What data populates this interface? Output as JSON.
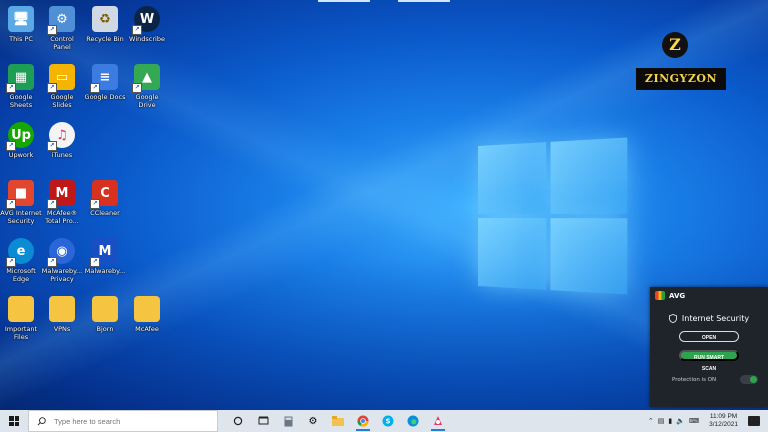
{
  "desktop": {
    "icons": [
      {
        "label": "This PC",
        "icon": "this-pc-icon",
        "color": "#5aa9e6"
      },
      {
        "label": "Control\nPanel",
        "icon": "control-panel-icon",
        "color": "#4f8fd6"
      },
      {
        "label": "Recycle Bin",
        "icon": "recycle-bin-icon",
        "color": "#cfd8e3"
      },
      {
        "label": "Windscribe",
        "icon": "windscribe-icon",
        "color": "#0b2345"
      },
      {
        "label": "Google\nSheets",
        "icon": "google-sheets-icon",
        "color": "#1e9d55"
      },
      {
        "label": "Google Slides",
        "icon": "google-slides-icon",
        "color": "#f4b400"
      },
      {
        "label": "Google Docs",
        "icon": "google-docs-icon",
        "color": "#3c7ce0"
      },
      {
        "label": "Google Drive",
        "icon": "google-drive-icon",
        "color": "#34a853"
      },
      {
        "label": "Upwork",
        "icon": "upwork-icon",
        "color": "#14a800"
      },
      {
        "label": "iTunes",
        "icon": "itunes-icon",
        "color": "#f4f4f4"
      },
      {
        "label": "AVG Internet\nSecurity",
        "icon": "avg-icon",
        "color": "#e2462f"
      },
      {
        "label": "McAfee®\nTotal Pro...",
        "icon": "mcafee-icon",
        "color": "#c01818"
      },
      {
        "label": "CCleaner",
        "icon": "ccleaner-icon",
        "color": "#d9311f"
      },
      {
        "label": "Microsoft\nEdge",
        "icon": "edge-icon",
        "color": "#0a8bd3"
      },
      {
        "label": "Malwareby...\nPrivacy",
        "icon": "malwarebytes-privacy-icon",
        "color": "#2a66d8"
      },
      {
        "label": "Malwareby...",
        "icon": "malwarebytes-icon",
        "color": "#1a4fc4"
      },
      {
        "label": "Important\nFiles",
        "icon": "folder-icon",
        "color": "#f5c542"
      },
      {
        "label": "VPNs",
        "icon": "folder-icon",
        "color": "#f5c542"
      },
      {
        "label": "Bjorn",
        "icon": "folder-icon",
        "color": "#f5c542"
      },
      {
        "label": "McAfee",
        "icon": "folder-icon",
        "color": "#f5c542"
      }
    ]
  },
  "watermark": {
    "letter": "Z",
    "word": "ZINGYZON"
  },
  "avg_popup": {
    "brand": "AVG",
    "product": "Internet Security",
    "open_label": "OPEN",
    "scan_label": "RUN SMART SCAN",
    "protection_label": "Protection is ON"
  },
  "taskbar": {
    "search_placeholder": "Type here to search",
    "time": "11:09 PM",
    "date": "3/12/2021"
  }
}
